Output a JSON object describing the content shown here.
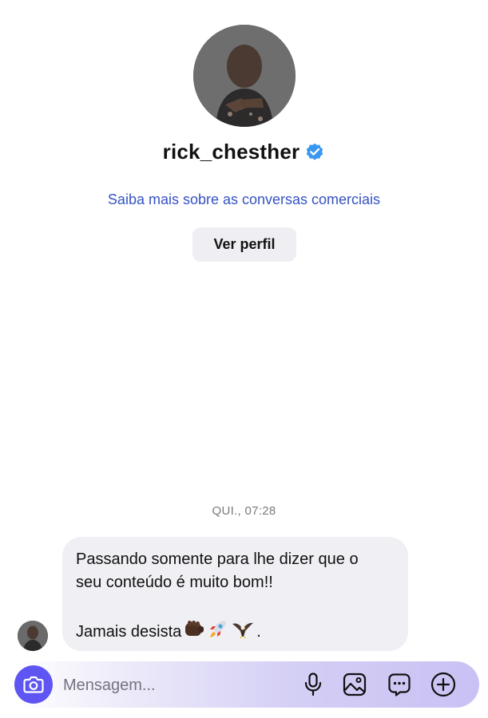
{
  "profile": {
    "username": "rick_chesther",
    "verified": true,
    "learn_more_link": "Saiba mais sobre as conversas comerciais",
    "view_profile_label": "Ver perfil"
  },
  "thread": {
    "timestamp": "QUI., 07:28",
    "messages": [
      {
        "line1": "Passando somente para lhe dizer que o",
        "line2": "seu conteúdo é muito bom!!",
        "signoff_text": "Jamais desista",
        "signoff_emojis": [
          "oncoming-fist",
          "rocket",
          "eagle"
        ],
        "signoff_end": "."
      }
    ]
  },
  "composer": {
    "placeholder": "Mensagem...",
    "icons": [
      "camera-icon",
      "microphone-icon",
      "gallery-icon",
      "sticker-chat-icon",
      "add-icon"
    ]
  },
  "colors": {
    "link": "#3552c4",
    "accent": "#5e55f3",
    "verified_badge": "#3897f0",
    "bubble": "#efeff4"
  }
}
